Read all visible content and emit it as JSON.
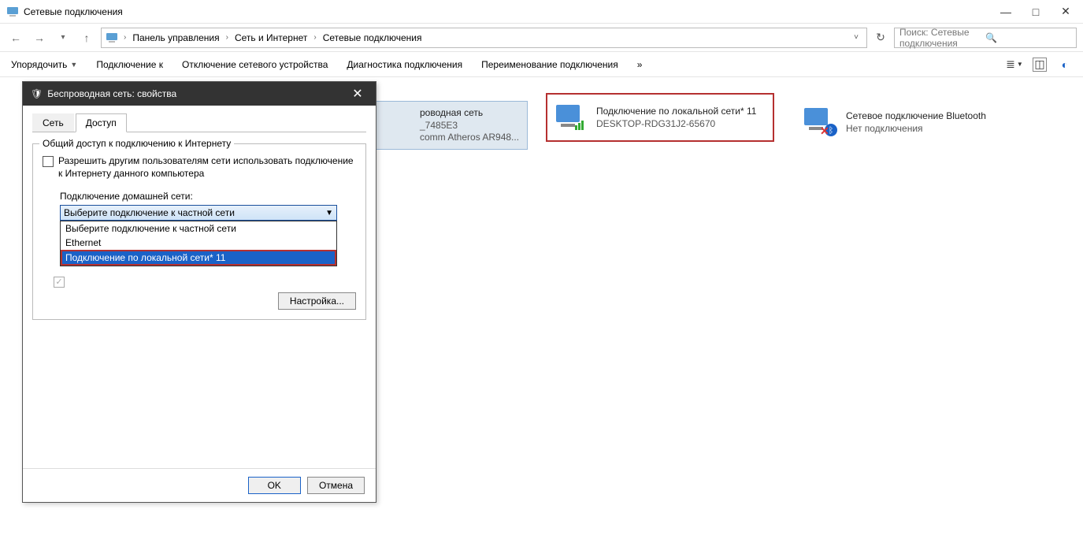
{
  "window": {
    "title": "Сетевые подключения",
    "controls": {
      "min": "—",
      "max": "□",
      "close": "✕"
    }
  },
  "nav": {
    "arrows": {
      "back": "←",
      "fwd": "→",
      "up": "↑"
    },
    "crumbs": [
      "Панель управления",
      "Сеть и Интернет",
      "Сетевые подключения"
    ],
    "search_placeholder": "Поиск: Сетевые подключения"
  },
  "toolbar": {
    "items": [
      "Упорядочить",
      "Подключение к",
      "Отключение сетевого устройства",
      "Диагностика подключения",
      "Переименование подключения"
    ],
    "more": "»"
  },
  "connections": [
    {
      "name_partial": "роводная сеть",
      "line2_partial": "_7485E3",
      "line3_partial": "comm Atheros AR948..."
    },
    {
      "name": "Подключение по локальной сети* 11",
      "line2": "DESKTOP-RDG31J2-65670",
      "highlight": true
    },
    {
      "name": "Сетевое подключение Bluetooth",
      "line2": "Нет подключения"
    }
  ],
  "dialog": {
    "title": "Беспроводная сеть: свойства",
    "tabs": [
      "Сеть",
      "Доступ"
    ],
    "active_tab": 1,
    "group_legend": "Общий доступ к подключению к Интернету",
    "checkbox1": "Разрешить другим пользователям сети использовать подключение к Интернету данного компьютера",
    "sublabel": "Подключение домашней сети:",
    "combo_value": "Выберите подключение к частной сети",
    "options": [
      "Выберите подключение к частной сети",
      "Ethernet",
      "Подключение по локальной сети* 11"
    ],
    "settings_btn": "Настройка...",
    "ok": "OK",
    "cancel": "Отмена"
  }
}
